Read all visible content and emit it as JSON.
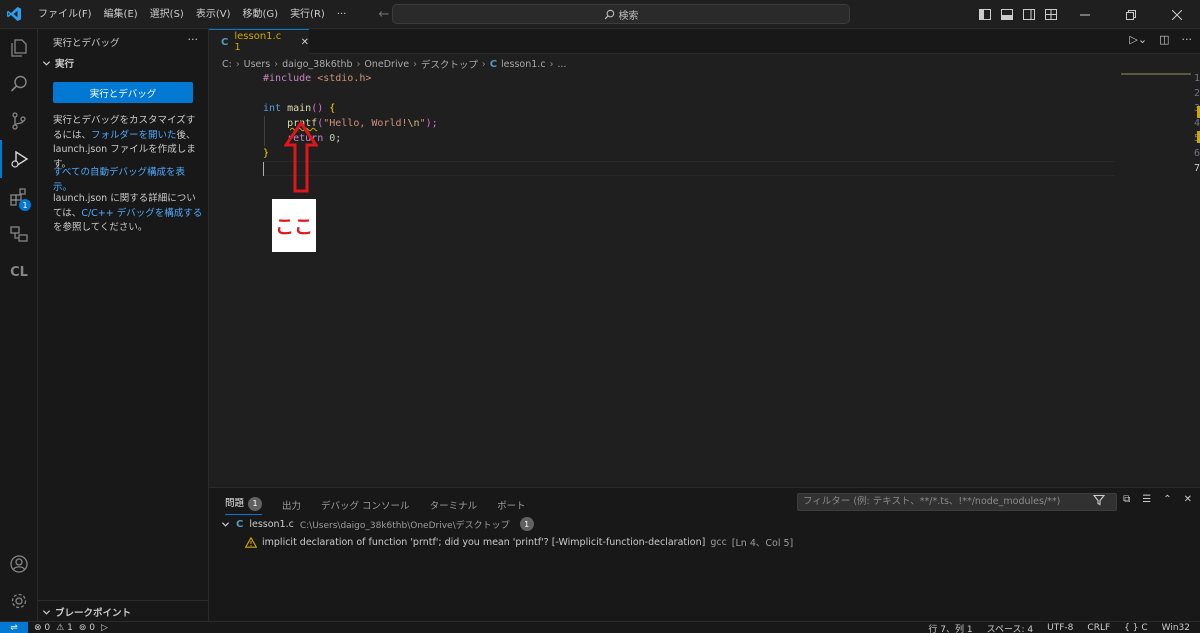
{
  "titlebar": {
    "menu": [
      "ファイル(F)",
      "編集(E)",
      "選択(S)",
      "表示(V)",
      "移動(G)",
      "実行(R)",
      "···"
    ],
    "search_label": "検索"
  },
  "sidebar": {
    "title": "実行とデバッグ",
    "more": "···",
    "section": "実行",
    "run_button": "実行とデバッグ",
    "customize_1": "実行とデバッグをカスタマイズするには、",
    "customize_link": "フォルダーを開いた",
    "customize_2": "後、launch.json ファイルを作成します。",
    "auto_debug_link": "すべての自動デバッグ構成を表示。",
    "details_1": "launch.json に関する詳細については、",
    "details_link": "C/C++ デバッグを構成する",
    "details_2": "を参照してください。",
    "breakpoints": "ブレークポイント"
  },
  "activity": {
    "extensions_badge": "1",
    "cl_label": "CL"
  },
  "editor": {
    "tab_label": "lesson1.c 1",
    "tab_icon_text": "C",
    "breadcrumb": [
      "C:",
      "Users",
      "daigo_38k6thb",
      "OneDrive",
      "デスクトップ",
      "lesson1.c",
      "..."
    ],
    "line_numbers": [
      "1",
      "2",
      "3",
      "4",
      "5",
      "6",
      "7"
    ],
    "code": {
      "l1_pp": "#include",
      "l1_rest": " <stdio.h>",
      "l3_kw": "int",
      "l3_fn": "main",
      "l3_rest": "() ",
      "l3_brace": "{",
      "l4_fn": "prntf",
      "l4_open": "(",
      "l4_str": "\"Hello, World!",
      "l4_esc": "\\n",
      "l4_strend": "\"",
      "l4_close": ");",
      "l5_kw": "return",
      "l5_num": "0",
      "l5_semi": ";",
      "l6_brace": "}"
    }
  },
  "annotation": {
    "label": "ここ"
  },
  "panel": {
    "tabs": [
      "問題",
      "出力",
      "デバッグ コンソール",
      "ターミナル",
      "ポート"
    ],
    "problems_count": "1",
    "filter_placeholder": "フィルター (例: テキスト、**/*.ts、!**/node_modules/**)",
    "file_name": "lesson1.c",
    "file_path": "C:\\Users\\daigo_38k6thb\\OneDrive\\デスクトップ",
    "file_count": "1",
    "message": "implicit declaration of function 'prntf'; did you mean 'printf'? [-Wimplicit-function-declaration]",
    "source": "gcc",
    "location": "[Ln 4、Col 5]"
  },
  "statusbar": {
    "errors": "0",
    "warnings": "1",
    "ports": "0",
    "position": "行 7、列 1",
    "spaces": "スペース: 4",
    "encoding": "UTF-8",
    "eol": "CRLF",
    "language": "C",
    "language_mode": "{ }",
    "config": "Win32"
  },
  "colors": {
    "accent": "#0078d4",
    "warning": "#cca700",
    "annotation": "#e0161b"
  }
}
